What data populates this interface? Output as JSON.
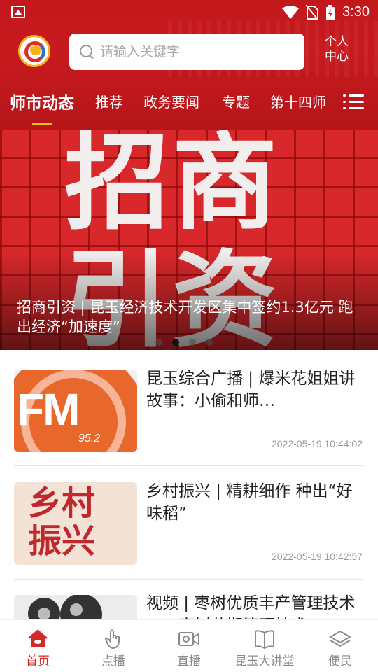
{
  "status_bar": {
    "time": "3:30"
  },
  "search": {
    "placeholder": "请输入关键字"
  },
  "profile": {
    "line1": "个人",
    "line2": "中心"
  },
  "tabs": [
    {
      "label": "师市动态",
      "active": true
    },
    {
      "label": "推荐"
    },
    {
      "label": "政务要闻"
    },
    {
      "label": "专题"
    },
    {
      "label": "第十四师"
    }
  ],
  "banner": {
    "image_text_top": "招商",
    "image_text_bottom": "引资",
    "caption": "招商引资 | 昆玉经济技术开发区集中签约1.3亿元 跑出经济“加速度”",
    "dot_count": 4,
    "active_dot": 2
  },
  "news": [
    {
      "title": "昆玉综合广播 | 爆米花姐姐讲故事：小偷和师…",
      "time": "2022-05-19 10:44:02",
      "thumb": {
        "text": "FM",
        "num": "95.2"
      }
    },
    {
      "title": "乡村振兴 | 精耕细作 种出“好味稻”",
      "time": "2022-05-19 10:42:57",
      "thumb": {
        "line1": "乡村",
        "line2": "振兴"
      }
    },
    {
      "title": "视频 | 枣树优质丰产管理技术——枣树花期管理技术",
      "time": ""
    }
  ],
  "bottom_nav": [
    {
      "label": "首页",
      "icon": "home-icon",
      "active": true
    },
    {
      "label": "点播",
      "icon": "touch-icon"
    },
    {
      "label": "直播",
      "icon": "video-camera-icon"
    },
    {
      "label": "昆玉大讲堂",
      "icon": "book-icon"
    },
    {
      "label": "便民",
      "icon": "layers-icon"
    }
  ],
  "colors": {
    "brand_red": "#c8191e",
    "accent_yellow": "#f5c518",
    "active_nav": "#d22a26"
  }
}
